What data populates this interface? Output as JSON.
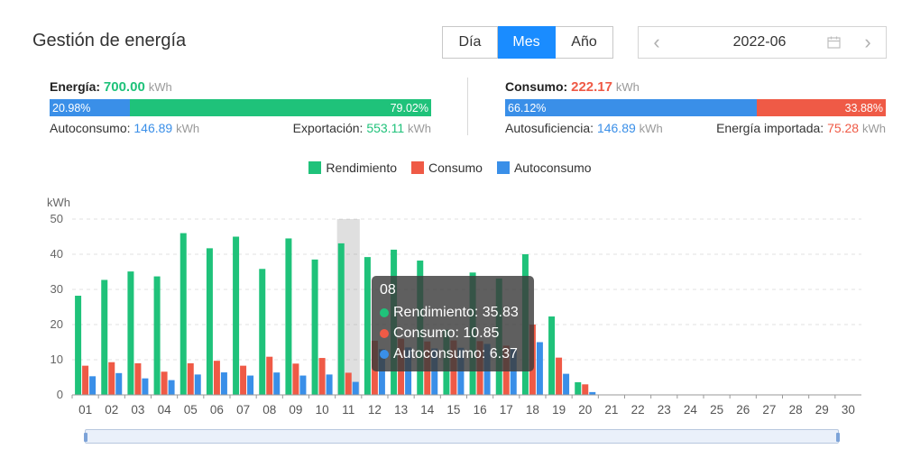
{
  "header": {
    "title": "Gestión de energía"
  },
  "period_tabs": [
    {
      "label": "Día",
      "active": false
    },
    {
      "label": "Mes",
      "active": true
    },
    {
      "label": "Año",
      "active": false
    }
  ],
  "date_picker": {
    "value": "2022-06",
    "prev_icon": "chevron-left-icon",
    "next_icon": "chevron-right-icon",
    "calendar_icon": "calendar-icon"
  },
  "energy": {
    "label": "Energía:",
    "value": "700.00",
    "unit": "kWh",
    "bar_left": "20.98%",
    "bar_right": "79.02%",
    "left_fraction": 0.2098,
    "right_fraction": 0.7902,
    "self_label": "Autoconsumo:",
    "self_value": "146.89",
    "self_unit": "kWh",
    "export_label": "Exportación:",
    "export_value": "553.11",
    "export_unit": "kWh"
  },
  "consumption": {
    "label": "Consumo:",
    "value": "222.17",
    "unit": "kWh",
    "bar_left": "66.12%",
    "bar_right": "33.88%",
    "left_fraction": 0.6612,
    "right_fraction": 0.3388,
    "sufficiency_label": "Autosuficiencia:",
    "sufficiency_value": "146.89",
    "sufficiency_unit": "kWh",
    "imported_label": "Energía importada:",
    "imported_value": "75.28",
    "imported_unit": "kWh"
  },
  "colors": {
    "green": "#1fc27a",
    "red": "#ef5a46",
    "blue": "#3a8fe8",
    "grid": "#e0e0e0",
    "axis": "#999999"
  },
  "tooltip": {
    "title": "08",
    "rows": [
      {
        "label": "Rendimiento: 35.83",
        "color": "#1fc27a"
      },
      {
        "label": "Consumo: 10.85",
        "color": "#ef5a46"
      },
      {
        "label": "Autoconsumo: 6.37",
        "color": "#3a8fe8"
      }
    ]
  },
  "chart_data": {
    "type": "bar",
    "ylabel": "kWh",
    "ylim": [
      0,
      50
    ],
    "yticks": [
      0,
      10,
      20,
      30,
      40,
      50
    ],
    "grid": true,
    "legend_position": "top-center",
    "categories": [
      "01",
      "02",
      "03",
      "04",
      "05",
      "06",
      "07",
      "08",
      "09",
      "10",
      "11",
      "12",
      "13",
      "14",
      "15",
      "16",
      "17",
      "18",
      "19",
      "20",
      "21",
      "22",
      "23",
      "24",
      "25",
      "26",
      "27",
      "28",
      "29",
      "30"
    ],
    "highlighted_category": "11",
    "series": [
      {
        "name": "Rendimiento",
        "color": "#1fc27a",
        "values": [
          28.2,
          32.7,
          35.1,
          33.7,
          46.0,
          41.7,
          45.0,
          35.83,
          44.5,
          38.5,
          43.1,
          39.2,
          41.3,
          38.2,
          18.5,
          34.8,
          33.1,
          40.0,
          22.3,
          3.6,
          0,
          0,
          0,
          0,
          0,
          0,
          0,
          0,
          0,
          0
        ]
      },
      {
        "name": "Consumo",
        "color": "#ef5a46",
        "values": [
          8.3,
          9.3,
          9.0,
          6.6,
          9.0,
          9.7,
          8.3,
          10.85,
          8.9,
          10.5,
          6.3,
          15.4,
          16.0,
          15.2,
          15.5,
          15.3,
          14.0,
          20.0,
          10.6,
          3.0,
          0,
          0,
          0,
          0,
          0,
          0,
          0,
          0,
          0,
          0
        ]
      },
      {
        "name": "Autoconsumo",
        "color": "#3a8fe8",
        "values": [
          5.3,
          6.2,
          4.7,
          4.2,
          5.8,
          6.4,
          5.5,
          6.37,
          5.5,
          5.8,
          3.7,
          13.0,
          13.5,
          13.2,
          13.4,
          14.5,
          13.0,
          15.0,
          6.0,
          0.8,
          0,
          0,
          0,
          0,
          0,
          0,
          0,
          0,
          0,
          0
        ]
      }
    ]
  }
}
